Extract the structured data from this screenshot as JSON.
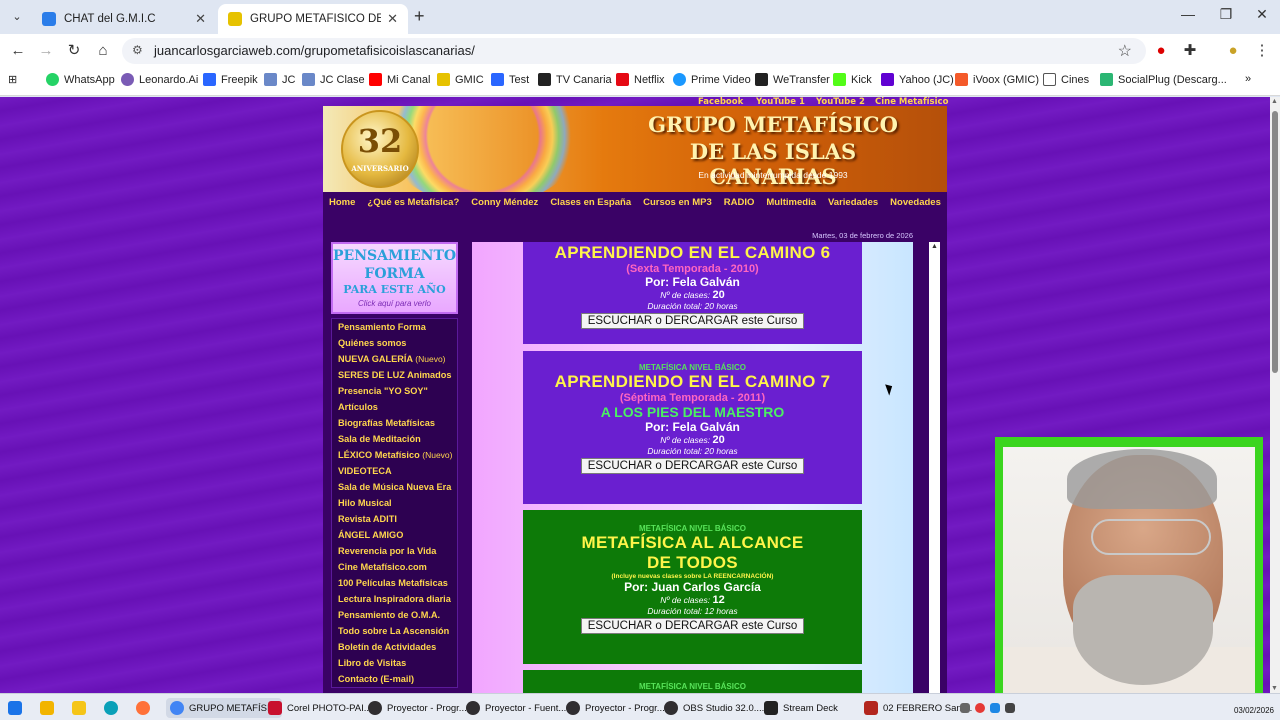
{
  "browser": {
    "tabs": [
      {
        "title": "CHAT del G.M.I.C",
        "favicon_color": "#2b7de9"
      },
      {
        "title": "GRUPO METAFÍSICO DE LAS ISLAS CANARIAS",
        "favicon_color": "#e6c200"
      }
    ],
    "url": "juancarlosgarciaweb.com/grupometafisicoislascanarias/",
    "bookmarks": [
      {
        "label": "WhatsApp",
        "color": "#25d366"
      },
      {
        "label": "Leonardo.Ai",
        "color": "#7a5bb5"
      },
      {
        "label": "Freepik",
        "color": "#2a66ff"
      },
      {
        "label": "JC",
        "color": "#6a88c8"
      },
      {
        "label": "JC Clase",
        "color": "#6a88c8"
      },
      {
        "label": "Mi Canal",
        "color": "#ff0000"
      },
      {
        "label": "GMIC",
        "color": "#e6c200"
      },
      {
        "label": "Test",
        "color": "#2a66ff"
      },
      {
        "label": "TV Canaria",
        "color": "#222222"
      },
      {
        "label": "Netflix",
        "color": "#e50914"
      },
      {
        "label": "Prime Video",
        "color": "#1a98ff"
      },
      {
        "label": "WeTransfer",
        "color": "#222222"
      },
      {
        "label": "Kick",
        "color": "#53fc18"
      },
      {
        "label": "Yahoo (JC)",
        "color": "#6001d2"
      },
      {
        "label": "iVoox (GMIC)",
        "color": "#f45a2a"
      },
      {
        "label": "Cines",
        "color": "#555555"
      },
      {
        "label": "SocialPlug (Descarg...",
        "color": "#2bb673"
      }
    ]
  },
  "site": {
    "top_links": [
      "Facebook",
      "YouTube 1",
      "YouTube 2",
      "Cine Metafísico"
    ],
    "banner": {
      "seal_number": "32",
      "seal_text": "ANIVERSARIO",
      "title_line1": "GRUPO METAFÍSICO",
      "title_line2": "DE LAS ISLAS CANARIAS",
      "subtitle": "En actividad ininterrumpida desde 1993"
    },
    "menu": [
      "Home",
      "¿Qué es Metafísica?",
      "Conny Méndez",
      "Clases en España",
      "Cursos en MP3",
      "RADIO",
      "Multimedia",
      "Variedades",
      "Novedades"
    ],
    "date": "Martes, 03 de febrero de 2026",
    "pensamiento": {
      "line1": "PENSAMIENTO",
      "line2": "FORMA",
      "line3": "PARA ESTE AÑO",
      "line4": "Click aquí para verlo"
    },
    "side_nav": [
      {
        "label": "Pensamiento Forma",
        "tag": ""
      },
      {
        "label": "Quiénes somos",
        "tag": ""
      },
      {
        "label": "NUEVA GALERÍA",
        "tag": "(Nuevo)"
      },
      {
        "label": "SERES DE LUZ Animados",
        "tag": ""
      },
      {
        "label": "Presencia \"YO SOY\"",
        "tag": ""
      },
      {
        "label": "Artículos",
        "tag": ""
      },
      {
        "label": "Biografías Metafísicas",
        "tag": ""
      },
      {
        "label": "Sala de Meditación",
        "tag": ""
      },
      {
        "label": "LÉXICO Metafísico",
        "tag": "(Nuevo)"
      },
      {
        "label": "VIDEOTECA",
        "tag": ""
      },
      {
        "label": "Sala de Música Nueva Era",
        "tag": ""
      },
      {
        "label": "Hilo Musical",
        "tag": ""
      },
      {
        "label": "Revista ADITI",
        "tag": ""
      },
      {
        "label": "ÁNGEL AMIGO",
        "tag": ""
      },
      {
        "label": "Reverencia por la Vida",
        "tag": ""
      },
      {
        "label": "Cine Metafísico.com",
        "tag": ""
      },
      {
        "label": "100 Películas Metafísicas",
        "tag": ""
      },
      {
        "label": "Lectura Inspiradora diaria",
        "tag": ""
      },
      {
        "label": "Pensamiento de O.M.A.",
        "tag": ""
      },
      {
        "label": "Todo sobre La Ascensión",
        "tag": ""
      },
      {
        "label": "Boletín de Actividades",
        "tag": ""
      },
      {
        "label": "Libro de Visitas",
        "tag": ""
      },
      {
        "label": "Contacto (E-mail)",
        "tag": ""
      }
    ],
    "courses": [
      {
        "level": "",
        "title": "APRENDIENDO EN EL CAMINO 6",
        "season": "(Sexta Temporada - 2010)",
        "extra": "",
        "by": "Por: Fela Galván",
        "classes_label": "Nº de clases:",
        "classes": "20",
        "duration_label": "Duración total:",
        "duration": "20 horas",
        "button": "ESCUCHAR o DERCARGAR este Curso"
      },
      {
        "level": "METAFÍSICA NIVEL BÁSICO",
        "title": "APRENDIENDO EN EL CAMINO 7",
        "season": "(Séptima Temporada - 2011)",
        "extra": "A LOS PIES DEL MAESTRO",
        "by": "Por: Fela Galván",
        "classes_label": "Nº de clases:",
        "classes": "20",
        "duration_label": "Duración total:",
        "duration": "20 horas",
        "button": "ESCUCHAR o DERCARGAR este Curso"
      },
      {
        "level": "METAFÍSICA NIVEL BÁSICO",
        "title_line1": "METAFÍSICA AL ALCANCE",
        "title_line2": "DE TODOS",
        "note": "(Incluye nuevas clases sobre LA REENCARNACIÓN)",
        "by": "Por: Juan Carlos García",
        "classes_label": "Nº de clases:",
        "classes": "12",
        "duration_label": "Duración total:",
        "duration": "12 horas",
        "button": "ESCUCHAR o DERCARGAR este Curso"
      },
      {
        "level": "METAFÍSICA NIVEL BÁSICO"
      }
    ]
  },
  "taskbar": {
    "apps": [
      {
        "label": "GRUPO METAFÍSI...",
        "color": "#4285f4"
      },
      {
        "label": "Corel PHOTO-PAI...",
        "color": "#c8102e"
      },
      {
        "label": "Proyector - Progr...",
        "color": "#302e31"
      },
      {
        "label": "Proyector - Fuent...",
        "color": "#302e31"
      },
      {
        "label": "Proyector - Progr...",
        "color": "#302e31"
      },
      {
        "label": "OBS Studio 32.0....",
        "color": "#302e31"
      },
      {
        "label": "Stream Deck",
        "color": "#222222"
      },
      {
        "label": "02 FEBRERO Sant...",
        "color": "#b3261e"
      }
    ],
    "date": "03/02/2026"
  }
}
